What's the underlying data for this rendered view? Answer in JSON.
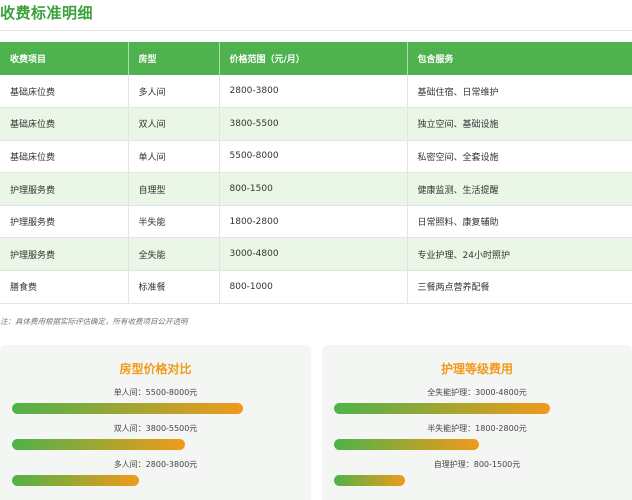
{
  "page": {
    "title": "收费标准明细"
  },
  "table": {
    "headers": [
      "收费项目",
      "房型",
      "价格范围（元/月）",
      "包含服务"
    ],
    "rows": [
      [
        "基础床位费",
        "多人间",
        "2800-3800",
        "基础住宿、日常维护"
      ],
      [
        "基础床位费",
        "双人间",
        "3800-5500",
        "独立空间、基础设施"
      ],
      [
        "基础床位费",
        "单人间",
        "5500-8000",
        "私密空间、全套设施"
      ],
      [
        "护理服务费",
        "自理型",
        "800-1500",
        "健康监测、生活提醒"
      ],
      [
        "护理服务费",
        "半失能",
        "1800-2800",
        "日常照料、康复辅助"
      ],
      [
        "护理服务费",
        "全失能",
        "3000-4800",
        "专业护理、24小时照护"
      ],
      [
        "膳食费",
        "标准餐",
        "800-1000",
        "三餐两点营养配餐"
      ]
    ]
  },
  "note": "注：具体费用根据实际评估确定，所有收费项目公开透明",
  "room_card": {
    "title": "房型价格对比",
    "bars": [
      {
        "label": "单人间：5500-8000元",
        "level": 1.0
      },
      {
        "label": "双人间：3800-5500元",
        "level": 0.75
      },
      {
        "label": "多人间：2800-3800元",
        "level": 0.55
      }
    ]
  },
  "care_card": {
    "title": "护理等级费用",
    "bars": [
      {
        "label": "全失能护理：3000-4800元",
        "level": 1.0
      },
      {
        "label": "半失能护理：1800-2800元",
        "level": 0.67
      },
      {
        "label": "自理护理：800-1500元",
        "level": 0.33
      }
    ]
  },
  "colors": {
    "brand_green": "#4eb24e",
    "title_green": "#3aa23a",
    "accent_orange": "#f29a1c",
    "row_alt": "#eaf6e6"
  }
}
